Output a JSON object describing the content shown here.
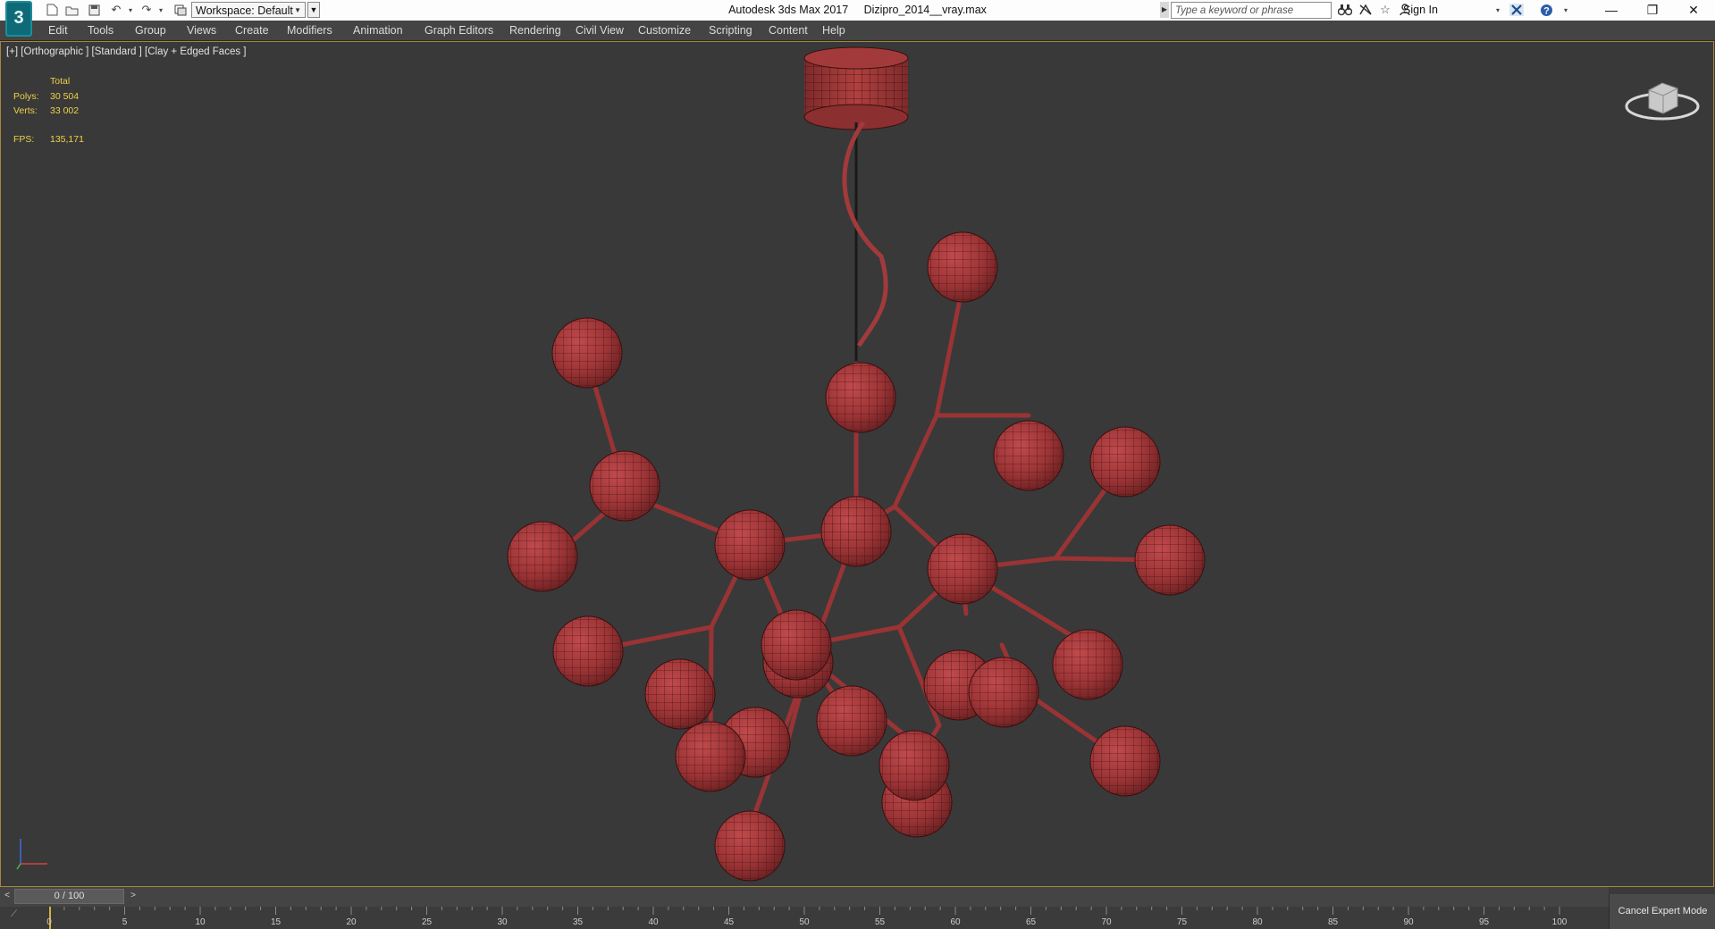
{
  "window": {
    "app_name": "Autodesk 3ds Max 2017",
    "file_name": "Dizipro_2014__vray.max",
    "workspace_label": "Workspace: Default",
    "search_placeholder": "Type a keyword or phrase",
    "sign_in_label": "Sign In",
    "minimize": "—",
    "restore": "❐",
    "close": "✕"
  },
  "quick_access": [
    {
      "name": "new-file-icon",
      "glyph": "🗋"
    },
    {
      "name": "open-file-icon",
      "glyph": "📂"
    },
    {
      "name": "save-icon",
      "glyph": "💾"
    },
    {
      "name": "undo-icon",
      "glyph": "↶"
    },
    {
      "name": "redo-icon",
      "glyph": "↷"
    },
    {
      "name": "project-folder-icon",
      "glyph": "▣"
    }
  ],
  "menu": [
    "Edit",
    "Tools",
    "Group",
    "Views",
    "Create",
    "Modifiers",
    "Animation",
    "Graph Editors",
    "Rendering",
    "Civil View",
    "Customize",
    "Scripting",
    "Content",
    "Help"
  ],
  "viewport": {
    "label": "[+] [Orthographic ] [Standard ] [Clay + Edged Faces ]",
    "stats": {
      "total_header": "Total",
      "polys_label": "Polys:",
      "polys_value": "30 504",
      "verts_label": "Verts:",
      "verts_value": "33 002",
      "fps_label": "FPS:",
      "fps_value": "135,171"
    },
    "model_color": "#a2383a"
  },
  "time_slider": {
    "position": "0 / 100",
    "current_frame": 0,
    "total_frames": 100,
    "prev": "<",
    "next": ">"
  },
  "trackbar": {
    "ticks": [
      "0",
      "5",
      "10",
      "15",
      "20",
      "25",
      "30",
      "35",
      "40",
      "45",
      "50",
      "55",
      "60",
      "65",
      "70",
      "75",
      "80",
      "85",
      "90",
      "95",
      "100"
    ]
  },
  "status": {
    "cancel_expert_mode": "Cancel Expert Mode"
  }
}
